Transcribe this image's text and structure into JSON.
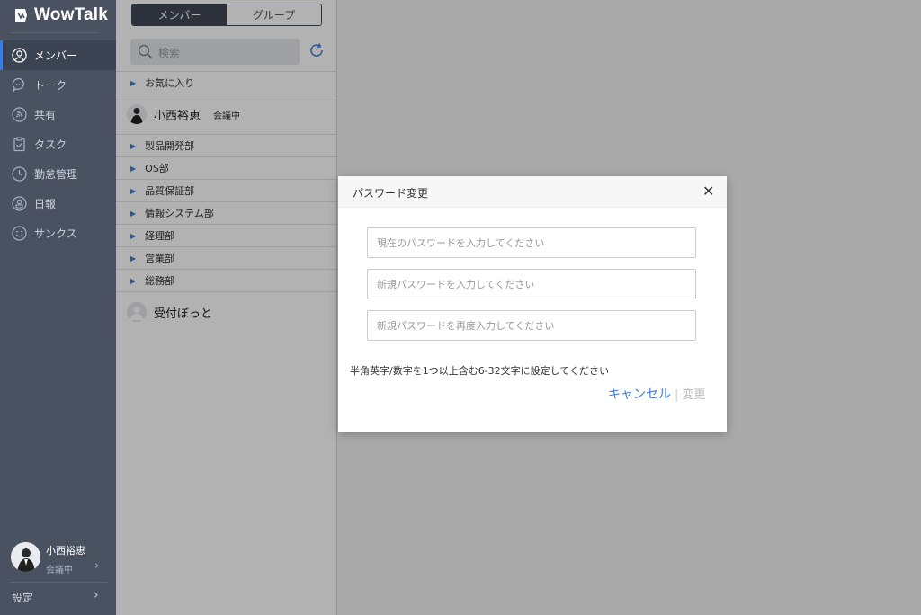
{
  "app": {
    "name": "WowTalk",
    "accent": "#3a7ddf",
    "sidebar_bg": "#4a5262"
  },
  "sidebar": {
    "items": [
      {
        "label": "メンバー",
        "icon": "member-icon",
        "active": true
      },
      {
        "label": "トーク",
        "icon": "chat-icon",
        "active": false
      },
      {
        "label": "共有",
        "icon": "share-icon",
        "active": false
      },
      {
        "label": "タスク",
        "icon": "task-icon",
        "active": false
      },
      {
        "label": "勤怠管理",
        "icon": "clock-icon",
        "active": false
      },
      {
        "label": "日報",
        "icon": "report-icon",
        "active": false
      },
      {
        "label": "サンクス",
        "icon": "smile-icon",
        "active": false
      }
    ],
    "user": {
      "name": "小西裕恵",
      "status": "会議中"
    },
    "settings_label": "設定"
  },
  "panel": {
    "tabs": [
      {
        "label": "メンバー",
        "active": true
      },
      {
        "label": "グループ",
        "active": false
      }
    ],
    "search_placeholder": "検索",
    "favorites": "お気に入り",
    "pinned_person": {
      "name": "小西裕恵",
      "status": "会議中"
    },
    "groups": [
      "製品開発部",
      "OS部",
      "品質保証部",
      "情報システム部",
      "経理部",
      "営業部",
      "総務部"
    ],
    "bot": {
      "name": "受付ぼっと"
    }
  },
  "dialog": {
    "title": "パスワード変更",
    "fields": [
      {
        "placeholder": "現在のパスワードを入力してください"
      },
      {
        "placeholder": "新規パスワードを入力してください"
      },
      {
        "placeholder": "新規パスワードを再度入力してください"
      }
    ],
    "hint": "半角英字/数字を1つ以上含む6-32文字に設定してください",
    "cancel_label": "キャンセル",
    "separator": "|",
    "change_label": "変更"
  }
}
